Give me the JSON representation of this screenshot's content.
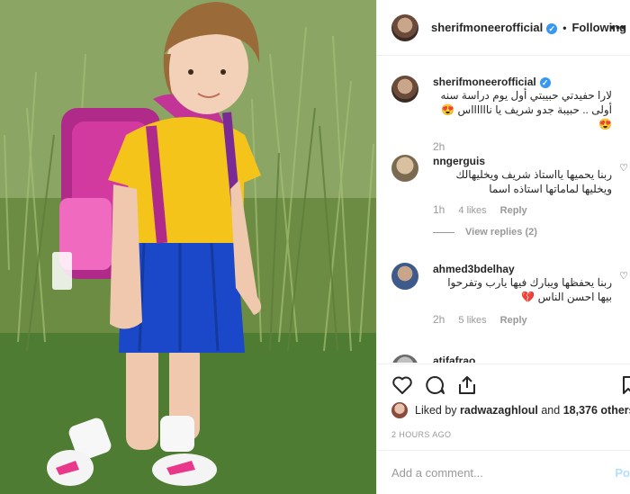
{
  "header": {
    "username": "sherifmoneerofficial",
    "verified_mark": "✓",
    "separator": "•",
    "follow_status": "Following",
    "more_icon": "more-options-icon"
  },
  "comments": [
    {
      "username": "sherifmoneerofficial",
      "text": "لارا حفيدتي حبيبتي أول يوم دراسة سنه أولى .. حبيبة جدو شريف يا نااااااس 😍😍",
      "time": "2h"
    },
    {
      "username": "nngerguis",
      "text": "ربنا يحميها يااستاذ شريف ويخليهالك ويخليها لماماتها استاذه اسما",
      "time": "1h",
      "likes": "4 likes",
      "reply_label": "Reply",
      "view_replies": "View replies (2)"
    },
    {
      "username": "ahmed3bdelhay",
      "text": "ربنا يحفظها ويبارك فيها يارب وتفرحوا بيها احسن الناس 💔",
      "time": "2h",
      "likes": "5 likes",
      "reply_label": "Reply"
    },
    {
      "username": "atifafrao",
      "text": "..."
    }
  ],
  "liked_by": {
    "prefix": "Liked by ",
    "user": "radwazaghloul",
    "middle": " and ",
    "count": "18,376 others"
  },
  "time_ago": "2 HOURS AGO",
  "add_comment_placeholder": "Add a comment...",
  "post_label": "Po"
}
